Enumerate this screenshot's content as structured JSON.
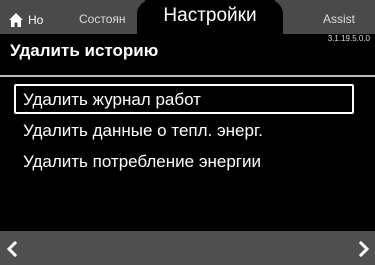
{
  "tabs": {
    "home": {
      "label": "Но",
      "icon": "home-icon"
    },
    "status": {
      "label": "Состоян"
    },
    "settings": {
      "label": "Настройки"
    },
    "assist": {
      "label": "Assist"
    }
  },
  "version": "3.1.19.5.0.0",
  "page": {
    "title": "Удалить историю"
  },
  "menu": {
    "items": [
      {
        "label": "Удалить журнал работ",
        "selected": true
      },
      {
        "label": "Удалить данные о тепл. энерг.",
        "selected": false
      },
      {
        "label": "Удалить потребление энергии",
        "selected": false
      }
    ]
  },
  "nav": {
    "back_icon": "chevron-left-icon",
    "forward_icon": "chevron-right-icon"
  },
  "colors": {
    "background": "#000000",
    "tab_inactive": "#4a4a4a",
    "bottom_bar": "#4f4f4f",
    "text": "#ffffff"
  }
}
